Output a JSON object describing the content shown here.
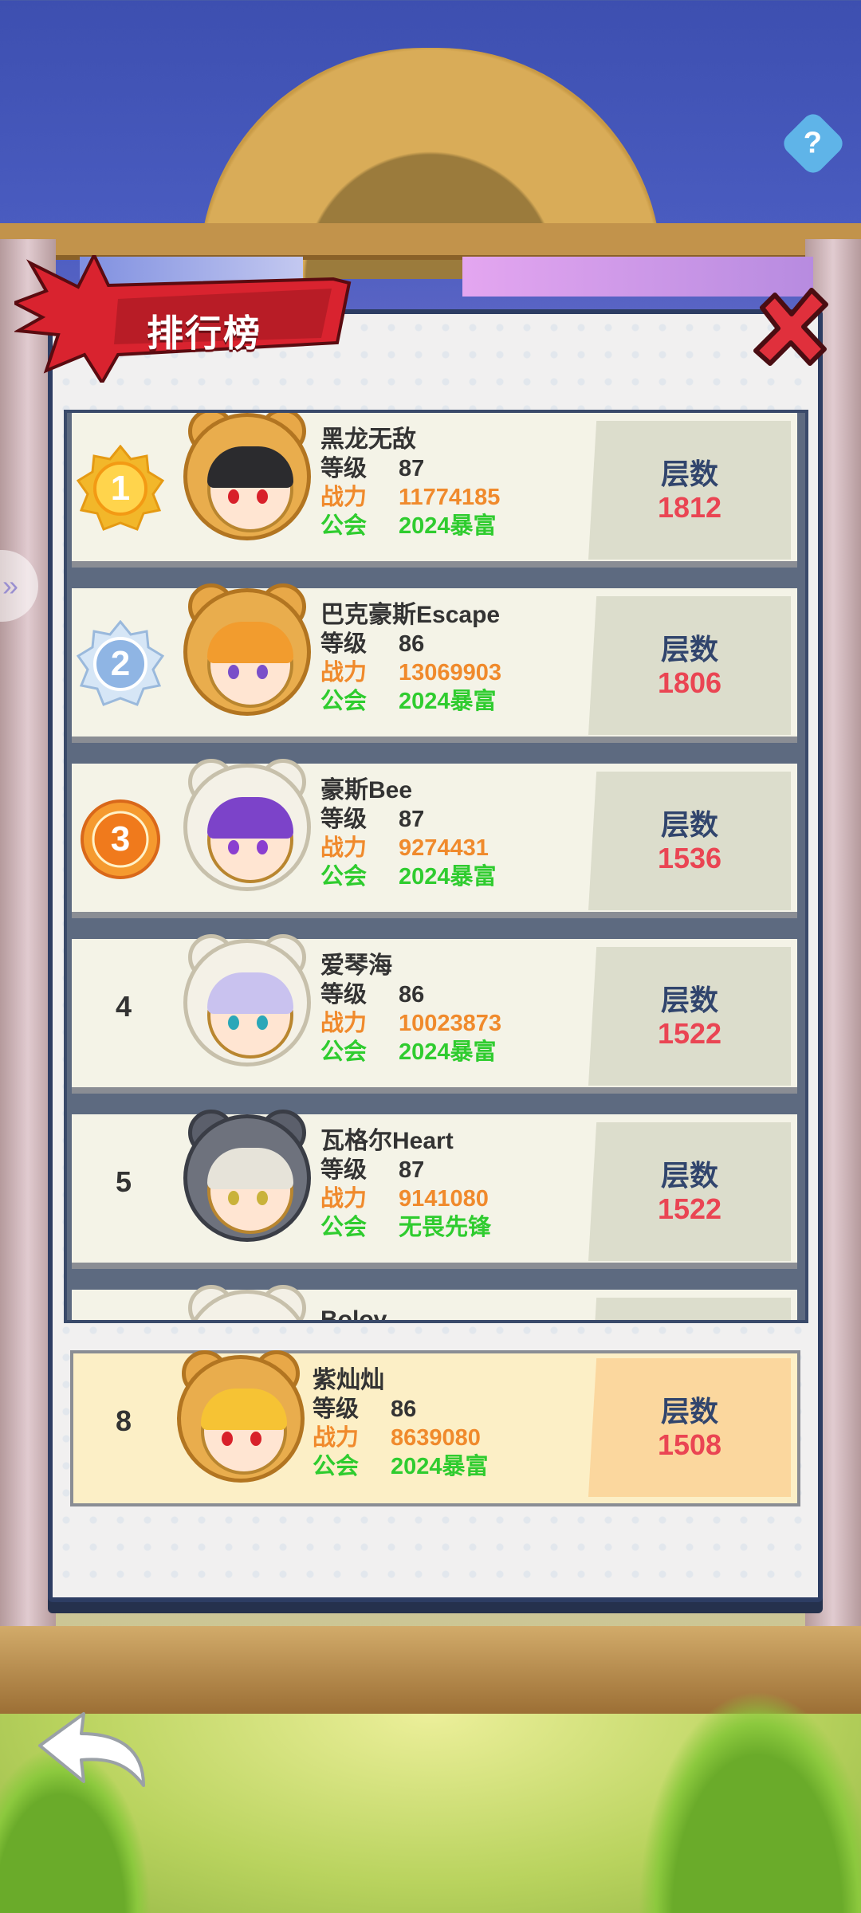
{
  "header": {
    "title": "排行榜"
  },
  "columns": {
    "level_label": "等级",
    "power_label": "战力",
    "guild_label": "公会",
    "score_label": "层数"
  },
  "rows": [
    {
      "rank": "1",
      "name": "黑龙无敌",
      "level": "87",
      "power": "11774185",
      "guild": "2024暴富",
      "score": "1812"
    },
    {
      "rank": "2",
      "name": "巴克豪斯Escape",
      "level": "86",
      "power": "13069903",
      "guild": "2024暴富",
      "score": "1806"
    },
    {
      "rank": "3",
      "name": "豪斯Bee",
      "level": "87",
      "power": "9274431",
      "guild": "2024暴富",
      "score": "1536"
    },
    {
      "rank": "4",
      "name": "爱琴海",
      "level": "86",
      "power": "10023873",
      "guild": "2024暴富",
      "score": "1522"
    },
    {
      "rank": "5",
      "name": "瓦格尔Heart",
      "level": "87",
      "power": "9141080",
      "guild": "无畏先锋",
      "score": "1522"
    }
  ],
  "partial_row": {
    "name": "Bolov"
  },
  "my_rank": {
    "rank": "8",
    "name": "紫灿灿",
    "level": "86",
    "power": "8639080",
    "guild": "2024暴富",
    "score": "1508"
  },
  "icons": {
    "close": "close-x-icon",
    "back": "back-arrow-icon",
    "help": "question-icon",
    "rank_1": "gold-medal-icon",
    "rank_2": "silver-medal-icon",
    "rank_3": "bronze-medal-icon"
  },
  "colors": {
    "power": "#f08a2c",
    "guild": "#2fcc2f",
    "score": "#ea4553",
    "score_label": "#31456d",
    "title_banner": "#d9232f"
  }
}
